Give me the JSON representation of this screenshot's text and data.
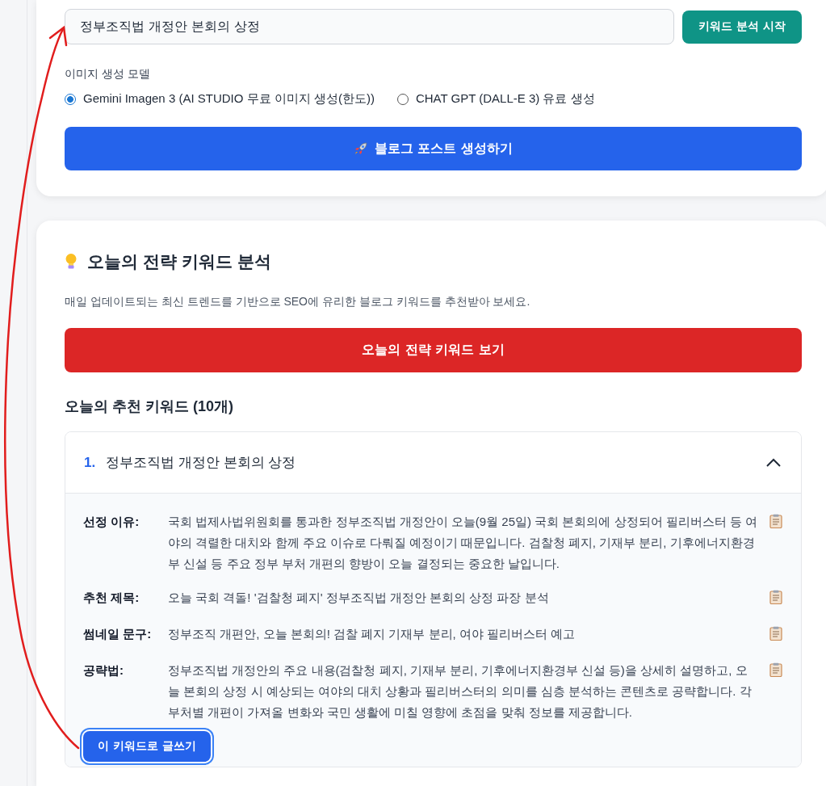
{
  "search_field": {
    "value": "정부조직법 개정안 본회의 상정"
  },
  "analyze_button": "키워드 분석 시작",
  "image_model": {
    "label": "이미지 생성 모델",
    "options": [
      {
        "label": "Gemini Imagen 3 (AI STUDIO 무료 이미지 생성(한도))",
        "selected": true
      },
      {
        "label": "CHAT GPT (DALL-E 3) 유료 생성",
        "selected": false
      }
    ]
  },
  "generate_button": "블로그 포스트 생성하기",
  "strategy": {
    "title": "오늘의 전략 키워드 분석",
    "description": "매일 업데이트되는 최신 트렌드를 기반으로 SEO에 유리한 블로그 키워드를 추천받아 보세요.",
    "button": "오늘의 전략 키워드 보기",
    "recommended_title": "오늘의 추천 키워드 (10개)",
    "keywords": [
      {
        "number": "1.",
        "title": "정부조직법 개정안 본회의 상정",
        "expanded": true,
        "details": [
          {
            "label": "선정 이유:",
            "text": "국회 법제사법위원회를 통과한 정부조직법 개정안이 오늘(9월 25일) 국회 본회의에 상정되어 필리버스터 등 여야의 격렬한 대치와 함께 주요 이슈로 다뤄질 예정이기 때문입니다. 검찰청 폐지, 기재부 분리, 기후에너지환경부 신설 등 주요 정부 부처 개편의 향방이 오늘 결정되는 중요한 날입니다."
          },
          {
            "label": "추천 제목:",
            "text": "오늘 국회 격돌! '검찰청 폐지' 정부조직법 개정안 본회의 상정 파장 분석"
          },
          {
            "label": "썸네일 문구:",
            "text": "정부조직 개편안, 오늘 본회의! 검찰 폐지 기재부 분리, 여야 필리버스터 예고"
          },
          {
            "label": "공략법:",
            "text": "정부조직법 개정안의 주요 내용(검찰청 폐지, 기재부 분리, 기후에너지환경부 신설 등)을 상세히 설명하고, 오늘 본회의 상정 시 예상되는 여야의 대치 상황과 필리버스터의 의미를 심층 분석하는 콘텐츠로 공략합니다. 각 부처별 개편이 가져올 변화와 국민 생활에 미칠 영향에 초점을 맞춰 정보를 제공합니다."
          }
        ],
        "write_button": "이 키워드로 글쓰기"
      }
    ]
  }
}
